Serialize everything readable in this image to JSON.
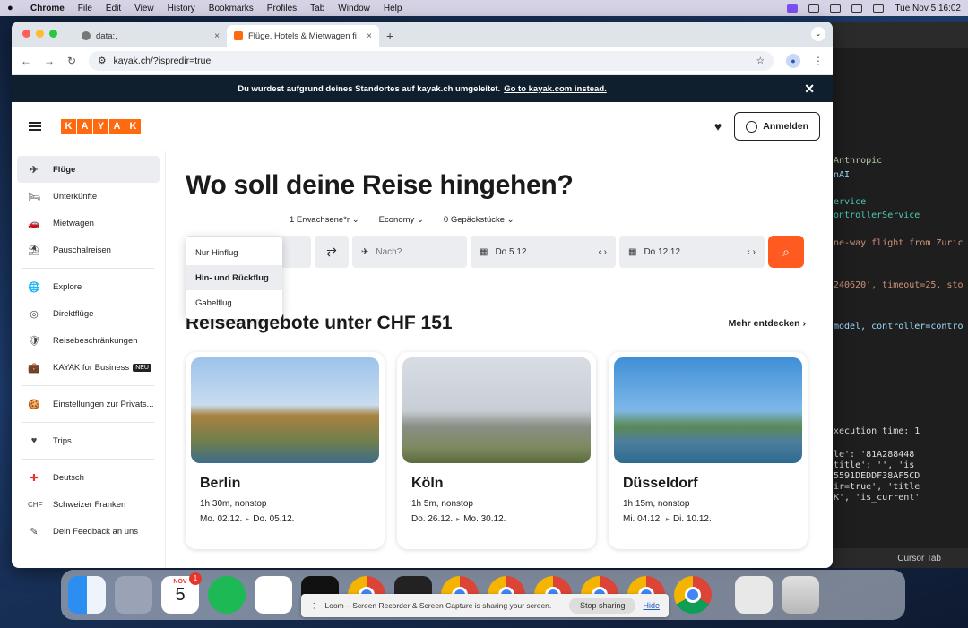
{
  "menubar": {
    "app": "Chrome",
    "items": [
      "File",
      "Edit",
      "View",
      "History",
      "Bookmarks",
      "Profiles",
      "Tab",
      "Window",
      "Help"
    ],
    "clock": "Tue Nov 5  16:02"
  },
  "browser": {
    "tabs": [
      {
        "title": "data:,",
        "close": "×"
      },
      {
        "title": "Flüge, Hotels & Mietwagen fi",
        "close": "×"
      }
    ],
    "new_tab": "+",
    "url": "kayak.ch/?ispredir=true"
  },
  "banner": {
    "text": "Du wurdest aufgrund deines Standortes auf kayak.ch umgeleitet.",
    "link": "Go to kayak.com instead.",
    "close": "✕"
  },
  "header": {
    "logo_letters": [
      "K",
      "A",
      "Y",
      "A",
      "K"
    ],
    "login": "Anmelden"
  },
  "sidebar": {
    "items": [
      {
        "label": "Flüge",
        "icon": "✈"
      },
      {
        "label": "Unterkünfte",
        "icon": "🛏"
      },
      {
        "label": "Mietwagen",
        "icon": "🚗"
      },
      {
        "label": "Pauschalreisen",
        "icon": "⛱"
      },
      {
        "label": "Explore",
        "icon": "🌐"
      },
      {
        "label": "Direktflüge",
        "icon": "◎"
      },
      {
        "label": "Reisebeschränkungen",
        "icon": "🛡"
      },
      {
        "label": "KAYAK for Business",
        "icon": "💼",
        "badge": "NEU"
      },
      {
        "label": "Einstellungen zur Privats...",
        "icon": "🍪"
      },
      {
        "label": "Trips",
        "icon": "♥"
      },
      {
        "label": "Deutsch",
        "icon": "✚"
      },
      {
        "label": "Schweizer Franken",
        "icon": "CHF"
      },
      {
        "label": "Dein Feedback an uns",
        "icon": "✎"
      }
    ]
  },
  "main": {
    "title": "Wo soll deine Reise hingehen?",
    "options": [
      "1 Erwachsene*r",
      "Economy",
      "0 Gepäckstücke"
    ],
    "trip_types": [
      "Nur Hinflug",
      "Hin- und Rückflug",
      "Gabelflug"
    ],
    "to_placeholder": "Nach?",
    "date_from": "Do 5.12.",
    "date_to": "Do 12.12.",
    "date_arrows": "‹  ›",
    "deals_title": "Reiseangebote unter CHF 151",
    "more": "Mehr entdecken",
    "cards": [
      {
        "city": "Berlin",
        "duration": "1h 30m, nonstop",
        "depart": "Mo. 02.12.",
        "return": "Do. 05.12."
      },
      {
        "city": "Köln",
        "duration": "1h 5m, nonstop",
        "depart": "Do. 26.12.",
        "return": "Mo. 30.12."
      },
      {
        "city": "Düsseldorf",
        "duration": "1h 15m, nonstop",
        "depart": "Mi. 04.12.",
        "return": "Di. 10.12."
      }
    ]
  },
  "editor": {
    "lines": [
      "Anthropic",
      "nAI",
      "ervice",
      "ontrollerService",
      "ne-way flight from Zuric",
      "240620', timeout=25, sto",
      "model, controller=contro"
    ],
    "terminal": [
      "xecution time: 1",
      "le': '81A288448",
      "title': '', 'is",
      "5591DEDDF38AF5CD",
      "ir=true', 'title",
      "K', 'is_current'"
    ],
    "status": "Cursor Tab"
  },
  "dock": {
    "calendar_month": "NOV",
    "calendar_day": "5",
    "calendar_badge": "1",
    "loom_text": "Loom – Screen Recorder & Screen Capture is sharing your screen.",
    "stop": "Stop sharing",
    "hide": "Hide"
  }
}
